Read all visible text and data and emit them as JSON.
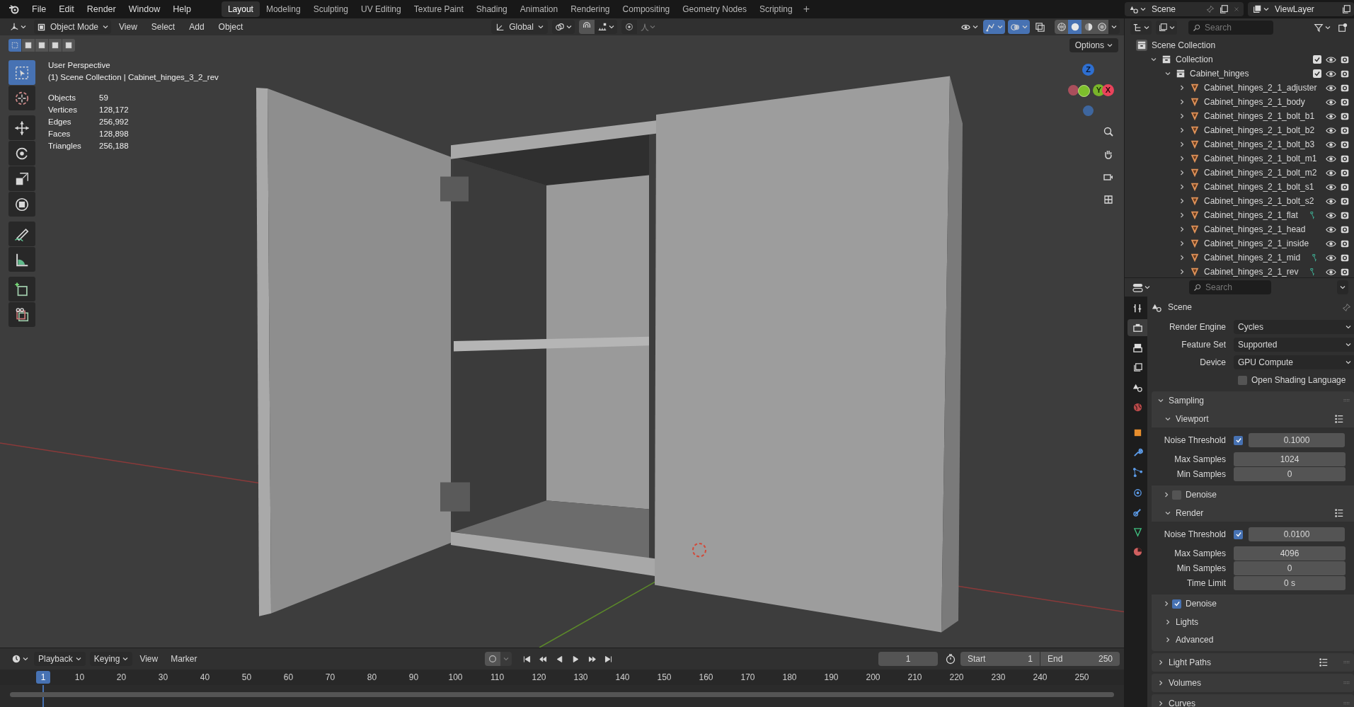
{
  "top_bar": {
    "menus": [
      "File",
      "Edit",
      "Render",
      "Window",
      "Help"
    ],
    "workspaces": [
      {
        "label": "Layout",
        "selected": true
      },
      {
        "label": "Modeling",
        "selected": false
      },
      {
        "label": "Sculpting",
        "selected": false
      },
      {
        "label": "UV Editing",
        "selected": false
      },
      {
        "label": "Texture Paint",
        "selected": false
      },
      {
        "label": "Shading",
        "selected": false
      },
      {
        "label": "Animation",
        "selected": false
      },
      {
        "label": "Rendering",
        "selected": false
      },
      {
        "label": "Compositing",
        "selected": false
      },
      {
        "label": "Geometry Nodes",
        "selected": false
      },
      {
        "label": "Scripting",
        "selected": false
      }
    ],
    "add_workspace": "+",
    "scene": "Scene",
    "view_layer": "ViewLayer"
  },
  "viewport": {
    "header": {
      "mode": "Object Mode",
      "menus": [
        "View",
        "Select",
        "Add",
        "Object"
      ],
      "orientation": "Global",
      "toggles": [
        {
          "kind": "visibility",
          "on": false
        },
        {
          "kind": "gizmos",
          "on": true
        },
        {
          "kind": "overlays",
          "on": true
        },
        {
          "kind": "xray",
          "on": false
        }
      ],
      "shading_modes": [
        {
          "kind": "wireframe",
          "selected": false
        },
        {
          "kind": "solid",
          "selected": true
        },
        {
          "kind": "material",
          "selected": false
        },
        {
          "kind": "rendered",
          "selected": false
        }
      ]
    },
    "select_modes": [
      {
        "selected": true
      },
      {
        "selected": false
      },
      {
        "selected": false
      },
      {
        "selected": false
      },
      {
        "selected": false
      }
    ],
    "options": "Options",
    "view_name": "User Perspective",
    "collection": "(1) Scene Collection | Cabinet_hinges_3_2_rev",
    "stats": [
      {
        "label": "Objects",
        "value": "59"
      },
      {
        "label": "Vertices",
        "value": "128,172"
      },
      {
        "label": "Edges",
        "value": "256,992"
      },
      {
        "label": "Faces",
        "value": "128,898"
      },
      {
        "label": "Triangles",
        "value": "256,188"
      }
    ],
    "tools": [
      {
        "kind": "select",
        "selected": true
      },
      {
        "kind": "cursor",
        "selected": false
      },
      {
        "kind": "move",
        "selected": false
      },
      {
        "kind": "rotate",
        "selected": false
      },
      {
        "kind": "scale",
        "selected": false
      },
      {
        "kind": "transform",
        "selected": false
      },
      {
        "kind": "annotate",
        "selected": false
      },
      {
        "kind": "measure",
        "selected": false
      },
      {
        "kind": "add_cube",
        "selected": false
      },
      {
        "kind": "cut",
        "selected": false
      }
    ],
    "gizmo_axes": [
      "Z",
      "Y",
      "X"
    ]
  },
  "outliner": {
    "search_placeholder": "Search",
    "tree": [
      {
        "kind": "scene_collection",
        "label": "Scene Collection",
        "children": [
          {
            "kind": "collection",
            "label": "Collection",
            "expanded": true,
            "checked": true,
            "children": [
              {
                "kind": "collection",
                "label": "Cabinet_hinges",
                "expanded": true,
                "checked": true,
                "children": [
                  {
                    "kind": "object",
                    "label": "Cabinet_hinges_2_1_adjuster",
                    "expanded": false,
                    "linked_data": false
                  },
                  {
                    "kind": "object",
                    "label": "Cabinet_hinges_2_1_body",
                    "expanded": false,
                    "linked_data": false
                  },
                  {
                    "kind": "object",
                    "label": "Cabinet_hinges_2_1_bolt_b1",
                    "expanded": false,
                    "linked_data": false
                  },
                  {
                    "kind": "object",
                    "label": "Cabinet_hinges_2_1_bolt_b2",
                    "expanded": false,
                    "linked_data": false
                  },
                  {
                    "kind": "object",
                    "label": "Cabinet_hinges_2_1_bolt_b3",
                    "expanded": false,
                    "linked_data": false
                  },
                  {
                    "kind": "object",
                    "label": "Cabinet_hinges_2_1_bolt_m1",
                    "expanded": false,
                    "linked_data": false
                  },
                  {
                    "kind": "object",
                    "label": "Cabinet_hinges_2_1_bolt_m2",
                    "expanded": false,
                    "linked_data": false
                  },
                  {
                    "kind": "object",
                    "label": "Cabinet_hinges_2_1_bolt_s1",
                    "expanded": false,
                    "linked_data": false
                  },
                  {
                    "kind": "object",
                    "label": "Cabinet_hinges_2_1_bolt_s2",
                    "expanded": false,
                    "linked_data": false
                  },
                  {
                    "kind": "object",
                    "label": "Cabinet_hinges_2_1_flat",
                    "expanded": false,
                    "linked_data": true
                  },
                  {
                    "kind": "object",
                    "label": "Cabinet_hinges_2_1_head",
                    "expanded": false,
                    "linked_data": false
                  },
                  {
                    "kind": "object",
                    "label": "Cabinet_hinges_2_1_inside",
                    "expanded": false,
                    "linked_data": false
                  },
                  {
                    "kind": "object",
                    "label": "Cabinet_hinges_2_1_mid",
                    "expanded": false,
                    "linked_data": true
                  },
                  {
                    "kind": "object",
                    "label": "Cabinet_hinges_2_1_rev",
                    "expanded": false,
                    "linked_data": true
                  }
                ]
              }
            ]
          }
        ]
      }
    ]
  },
  "properties": {
    "search_placeholder": "Search",
    "context": "Scene",
    "tabs": [
      {
        "kind": "tool",
        "selected": false
      },
      {
        "kind": "render",
        "selected": true
      },
      {
        "kind": "output",
        "selected": false
      },
      {
        "kind": "view_layer",
        "selected": false
      },
      {
        "kind": "scene",
        "selected": false
      },
      {
        "kind": "world",
        "selected": false
      },
      {
        "kind": "object",
        "selected": false
      },
      {
        "kind": "modifiers",
        "selected": false
      },
      {
        "kind": "particles",
        "selected": false
      },
      {
        "kind": "physics",
        "selected": false
      },
      {
        "kind": "constraints",
        "selected": false
      },
      {
        "kind": "data",
        "selected": false
      },
      {
        "kind": "material",
        "selected": false
      }
    ],
    "rows": [
      {
        "kind": "dropdown",
        "label": "Render Engine",
        "value": "Cycles"
      },
      {
        "kind": "dropdown",
        "label": "Feature Set",
        "value": "Supported"
      },
      {
        "kind": "dropdown",
        "label": "Device",
        "value": "GPU Compute"
      },
      {
        "kind": "checkbox",
        "label": "Open Shading Language",
        "checked": false
      },
      {
        "kind": "panel",
        "label": "Sampling",
        "expanded": true,
        "children": [
          {
            "kind": "subpanel",
            "label": "Viewport",
            "expanded": true,
            "children": [
              {
                "kind": "toggle_number",
                "label": "Noise Threshold",
                "checked": true,
                "value": "0.1000"
              },
              {
                "kind": "number",
                "label": "Max Samples",
                "value": "1024"
              },
              {
                "kind": "number",
                "label": "Min Samples",
                "value": "0"
              }
            ]
          },
          {
            "kind": "check_subpanel",
            "label": "Denoise",
            "expanded": false,
            "checked": false
          },
          {
            "kind": "subpanel",
            "label": "Render",
            "expanded": true,
            "children": [
              {
                "kind": "toggle_number",
                "label": "Noise Threshold",
                "checked": true,
                "value": "0.0100"
              },
              {
                "kind": "number",
                "label": "Max Samples",
                "value": "4096"
              },
              {
                "kind": "number",
                "label": "Min Samples",
                "value": "0"
              },
              {
                "kind": "number",
                "label": "Time Limit",
                "value": "0 s"
              }
            ]
          },
          {
            "kind": "check_subpanel",
            "label": "Denoise",
            "expanded": false,
            "checked": true
          },
          {
            "kind": "subpanel",
            "label": "Lights",
            "expanded": false
          },
          {
            "kind": "subpanel",
            "label": "Advanced",
            "expanded": false
          }
        ]
      },
      {
        "kind": "panel",
        "label": "Light Paths",
        "expanded": false
      },
      {
        "kind": "panel",
        "label": "Volumes",
        "expanded": false
      },
      {
        "kind": "panel",
        "label": "Curves",
        "expanded": false
      }
    ]
  },
  "timeline": {
    "menus": [
      {
        "kind": "dropdown",
        "label": "Playback"
      },
      {
        "kind": "dropdown",
        "label": "Keying"
      },
      {
        "kind": "menu",
        "label": "View"
      },
      {
        "kind": "menu",
        "label": "Marker"
      }
    ],
    "current_frame": "1",
    "start": {
      "label": "Start",
      "value": "1"
    },
    "end": {
      "label": "End",
      "value": "250"
    },
    "playhead": "1",
    "ticks": [
      "10",
      "20",
      "30",
      "40",
      "50",
      "60",
      "70",
      "80",
      "90",
      "100",
      "110",
      "120",
      "130",
      "140",
      "150",
      "160",
      "170",
      "180",
      "190",
      "200",
      "210",
      "220",
      "230",
      "240",
      "250"
    ]
  }
}
